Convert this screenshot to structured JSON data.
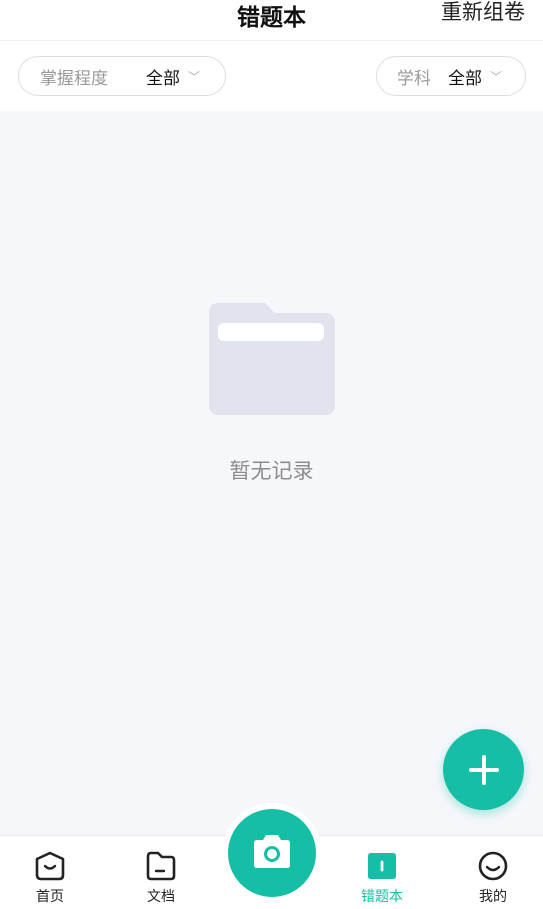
{
  "header": {
    "title": "错题本",
    "action": "重新组卷"
  },
  "filters": {
    "mastery": {
      "label": "掌握程度",
      "value": "全部"
    },
    "subject": {
      "label": "学科",
      "value": "全部"
    },
    "chevron": "﹀"
  },
  "empty_state": {
    "icon": "folder-icon",
    "text": "暂无记录"
  },
  "fab": {
    "icon": "plus-icon"
  },
  "camera": {
    "icon": "camera-icon"
  },
  "nav": {
    "items": [
      {
        "label": "首页",
        "icon": "home-face-icon"
      },
      {
        "label": "文档",
        "icon": "document-icon"
      },
      {
        "label": "错题本",
        "icon": "mistake-book-icon",
        "active": true
      },
      {
        "label": "我的",
        "icon": "profile-face-icon"
      }
    ]
  },
  "colors": {
    "accent": "#14bfa6",
    "background": "#f6f7fb",
    "folder": "#e1e3ee"
  }
}
